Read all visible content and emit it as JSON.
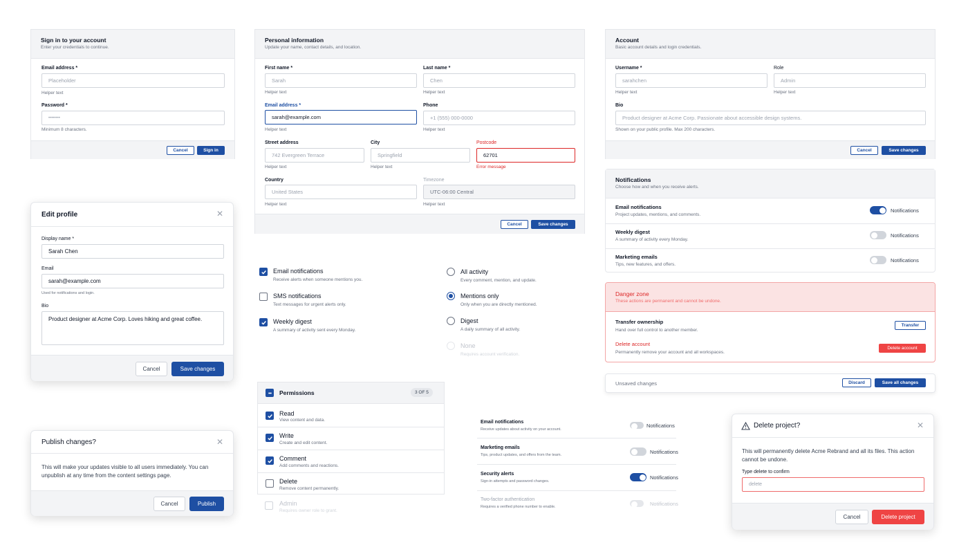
{
  "signin": {
    "title": "Sign in to your account",
    "subtitle": "Enter your credentials to continue.",
    "email_label": "Email address *",
    "email_placeholder": "Placeholder",
    "email_helper": "Helper text",
    "password_label": "Password *",
    "password_value": "••••••••",
    "password_helper": "Minimum 8 characters.",
    "cancel": "Cancel",
    "submit": "Sign in"
  },
  "personal": {
    "title": "Personal information",
    "subtitle": "Update your name, contact details, and location.",
    "first_label": "First name *",
    "first_value": "Sarah",
    "first_helper": "Helper text",
    "last_label": "Last name *",
    "last_value": "Chen",
    "last_helper": "Helper text",
    "email_label": "Email address *",
    "email_value": "sarah@example.com",
    "email_helper": "Helper text",
    "phone_label": "Phone",
    "phone_value": "+1 (555) 000-0000",
    "phone_helper": "Helper text",
    "street_label": "Street address",
    "street_value": "742 Evergreen Terrace",
    "street_helper": "Helper text",
    "city_label": "City",
    "city_value": "Springfield",
    "city_helper": "Helper text",
    "postcode_label": "Postcode",
    "postcode_value": "62701",
    "postcode_error": "Error message",
    "country_label": "Country",
    "country_value": "United States",
    "country_helper": "Helper text",
    "timezone_label": "Timezone",
    "timezone_value": "UTC-06:00 Central",
    "timezone_helper": "Helper text",
    "cancel": "Cancel",
    "save": "Save changes"
  },
  "account": {
    "title": "Account",
    "subtitle": "Basic account details and login credentials.",
    "username_label": "Username *",
    "username_value": "sarahchen",
    "username_helper": "Helper text",
    "role_label": "Role",
    "role_value": "Admin",
    "role_helper": "Helper text",
    "bio_label": "Bio",
    "bio_value": "Product designer at Acme Corp. Passionate about accessible design systems.",
    "bio_helper": "Shown on your public profile. Max 200 characters.",
    "cancel": "Cancel",
    "save": "Save changes"
  },
  "notifications": {
    "title": "Notifications",
    "subtitle": "Choose how and when you receive alerts.",
    "rows": [
      {
        "title": "Email notifications",
        "sub": "Project updates, mentions, and comments.",
        "toggle": "Notifications",
        "on": true
      },
      {
        "title": "Weekly digest",
        "sub": "A summary of activity every Monday.",
        "toggle": "Notifications",
        "on": false
      },
      {
        "title": "Marketing emails",
        "sub": "Tips, new features, and offers.",
        "toggle": "Notifications",
        "on": false
      }
    ]
  },
  "danger": {
    "title": "Danger zone",
    "subtitle": "These actions are permanent and cannot be undone.",
    "transfer_title": "Transfer ownership",
    "transfer_sub": "Hand over full control to another member.",
    "transfer_button": "Transfer",
    "delete_title": "Delete account",
    "delete_sub": "Permanently remove your account and all workspaces.",
    "delete_button": "Delete account"
  },
  "unsaved": {
    "text": "Unsaved changes",
    "discard": "Discard",
    "save_all": "Save all changes"
  },
  "edit_profile": {
    "title": "Edit profile",
    "name_label": "Display name *",
    "name_value": "Sarah Chen",
    "email_label": "Email",
    "email_value": "sarah@example.com",
    "email_helper": "Used for notifications and login.",
    "bio_label": "Bio",
    "bio_value": "Product designer at Acme Corp. Loves hiking and great coffee.",
    "cancel": "Cancel",
    "save": "Save changes"
  },
  "checkboxes": [
    {
      "label": "Email notifications",
      "sub": "Receive alerts when someone mentions you.",
      "checked": true
    },
    {
      "label": "SMS notifications",
      "sub": "Text messages for urgent alerts only.",
      "checked": false
    },
    {
      "label": "Weekly digest",
      "sub": "A summary of activity sent every Monday.",
      "checked": true
    }
  ],
  "radios": [
    {
      "label": "All activity",
      "sub": "Every comment, mention, and update.",
      "selected": false
    },
    {
      "label": "Mentions only",
      "sub": "Only when you are directly mentioned.",
      "selected": true
    },
    {
      "label": "Digest",
      "sub": "A daily summary of all activity.",
      "selected": false
    },
    {
      "label": "None",
      "sub": "Requires account verification.",
      "disabled": true
    }
  ],
  "permissions": {
    "title": "Permissions",
    "count": "3 OF 5",
    "items": [
      {
        "label": "Read",
        "sub": "View content and data.",
        "checked": true
      },
      {
        "label": "Write",
        "sub": "Create and edit content.",
        "checked": true
      },
      {
        "label": "Comment",
        "sub": "Add comments and reactions.",
        "checked": true
      },
      {
        "label": "Delete",
        "sub": "Remove content permanently.",
        "checked": false
      },
      {
        "label": "Admin",
        "sub": "Requires owner role to grant.",
        "disabled": true
      }
    ]
  },
  "toggle_list": [
    {
      "title": "Email notifications",
      "sub": "Receive updates about activity on your account.",
      "toggle": "Notifications",
      "state": "off"
    },
    {
      "title": "Marketing emails",
      "sub": "Tips, product updates, and offers from the team.",
      "toggle": "Notifications",
      "state": "off"
    },
    {
      "title": "Security alerts",
      "sub": "Sign-in attempts and password changes.",
      "toggle": "Notifications",
      "state": "on"
    },
    {
      "title": "Two-factor authentication",
      "sub": "Requires a verified phone number to enable.",
      "toggle": "Notifications",
      "state": "disabled"
    }
  ],
  "publish": {
    "title": "Publish changes?",
    "text": "This will make your updates visible to all users immediately. You can unpublish at any time from the content settings page.",
    "cancel": "Cancel",
    "confirm": "Publish"
  },
  "delete_project": {
    "title": "Delete project?",
    "text": "This will permanently delete Acme Rebrand and all its files. This action cannot be undone.",
    "confirm_label": "Type delete to confirm",
    "confirm_placeholder": "delete",
    "cancel": "Cancel",
    "delete": "Delete project"
  },
  "colors": {
    "primary": "#1e4fa3",
    "danger": "#ef4444",
    "danger_bg": "#fbe3e3"
  }
}
